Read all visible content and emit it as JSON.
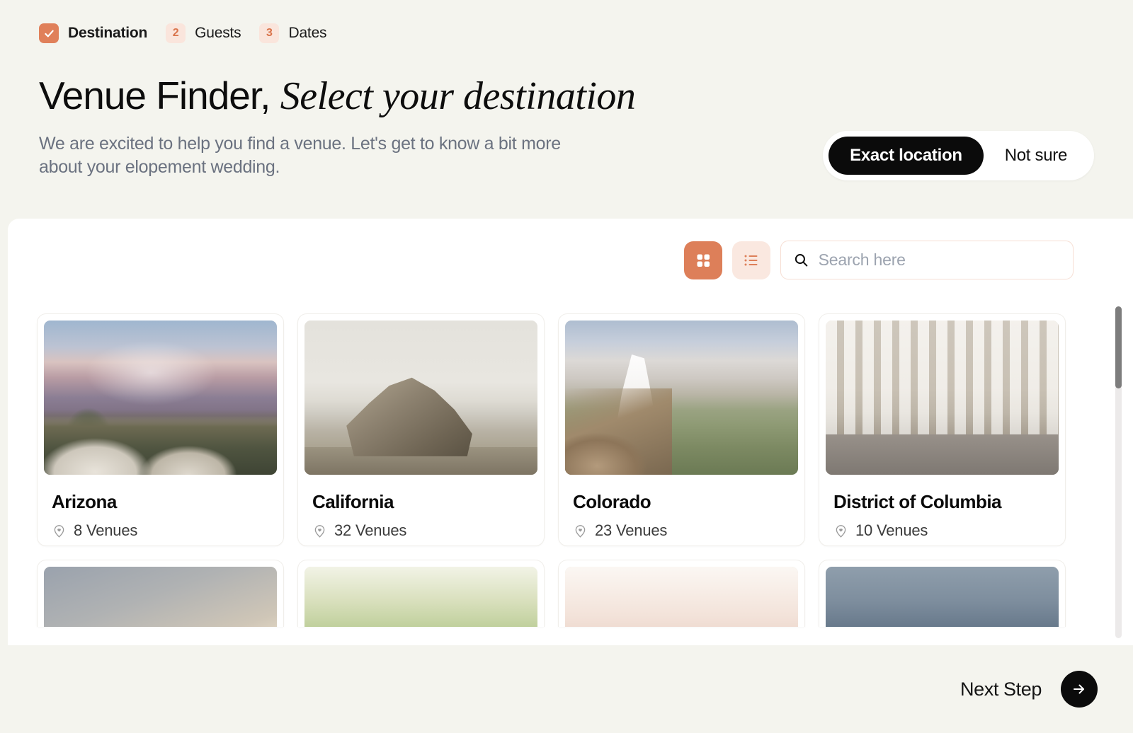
{
  "steps": [
    {
      "badge": "✓",
      "label": "Destination",
      "state": "done"
    },
    {
      "badge": "2",
      "label": "Guests",
      "state": "todo"
    },
    {
      "badge": "3",
      "label": "Dates",
      "state": "todo"
    }
  ],
  "header": {
    "title_plain": "Venue Finder,",
    "title_italic": "Select your destination",
    "subtitle": "We are excited to help you find a venue. Let's get to know a bit more about your elopement wedding."
  },
  "location_toggle": {
    "options": [
      "Exact location",
      "Not sure"
    ],
    "selected": "Exact location"
  },
  "toolbar": {
    "grid_view": "grid-view",
    "list_view": "list-view",
    "active_view": "grid-view",
    "search_placeholder": "Search here",
    "search_value": ""
  },
  "venues": [
    {
      "name": "Arizona",
      "count": "8 Venues",
      "photo": "ph-az"
    },
    {
      "name": "California",
      "count": "32 Venues",
      "photo": "ph-ca"
    },
    {
      "name": "Colorado",
      "count": "23 Venues",
      "photo": "ph-co"
    },
    {
      "name": "District of Columbia",
      "count": "10 Venues",
      "photo": "ph-dc"
    }
  ],
  "venues_row2": [
    {
      "photo": "ph-r1"
    },
    {
      "photo": "ph-r2"
    },
    {
      "photo": "ph-r3"
    },
    {
      "photo": "ph-r4"
    }
  ],
  "footer": {
    "next_label": "Next Step"
  },
  "colors": {
    "background": "#f4f4ee",
    "panel": "#ffffff",
    "accent": "#dd7f59",
    "accent_soft": "#fae5dc",
    "dark": "#0b0b0b",
    "muted_text": "#6b7280"
  }
}
